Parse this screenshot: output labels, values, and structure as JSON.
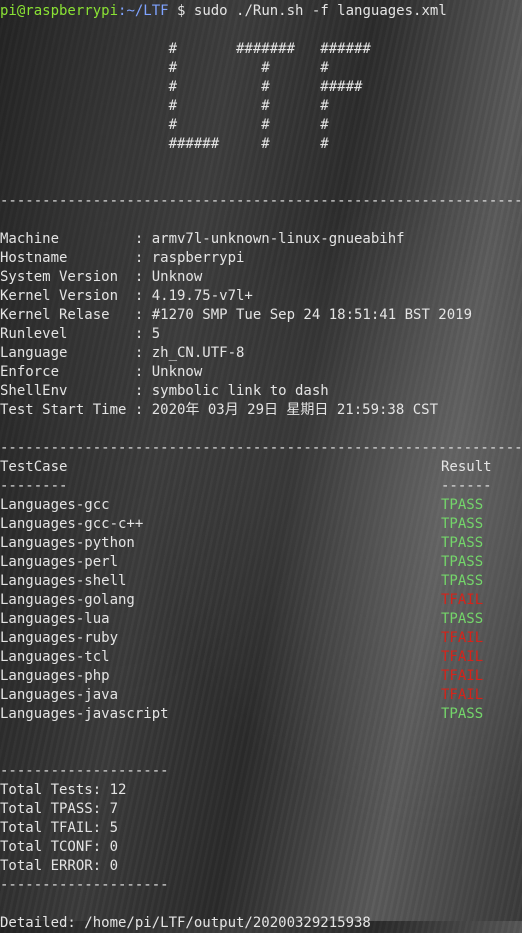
{
  "prompt": {
    "user_host": "pi@raspberrypi",
    "path": ":~/LTF",
    "symbol": " $ ",
    "command": "sudo ./Run.sh -f languages.xml"
  },
  "banner": [
    "                    #       #######   ######",
    "                    #          #      #",
    "                    #          #      #####",
    "                    #          #      #",
    "                    #          #      #",
    "                    ######     #      #"
  ],
  "separators": {
    "long": "--------------------------------------------------------------------",
    "short": "--------------------"
  },
  "system_info": [
    {
      "key": "Machine         ",
      "value": "armv7l-unknown-linux-gnueabihf"
    },
    {
      "key": "Hostname        ",
      "value": "raspberrypi"
    },
    {
      "key": "System Version  ",
      "value": "Unknow"
    },
    {
      "key": "Kernel Version  ",
      "value": "4.19.75-v7l+"
    },
    {
      "key": "Kernel Relase   ",
      "value": "#1270 SMP Tue Sep 24 18:51:41 BST 2019"
    },
    {
      "key": "Runlevel        ",
      "value": "5"
    },
    {
      "key": "Language        ",
      "value": "zh_CN.UTF-8"
    },
    {
      "key": "Enforce         ",
      "value": "Unknow"
    },
    {
      "key": "ShellEnv        ",
      "value": "symbolic link to dash"
    },
    {
      "key": "Test Start Time ",
      "value": "2020年 03月 29日 星期日 21:59:38 CST"
    }
  ],
  "results_header": {
    "testcase": "TestCase",
    "result": "Result",
    "testcase_underline": "--------",
    "result_underline": "------"
  },
  "results": [
    {
      "name": "Languages-gcc",
      "result": "TPASS",
      "color": "#74d66a"
    },
    {
      "name": "Languages-gcc-c++",
      "result": "TPASS",
      "color": "#74d66a"
    },
    {
      "name": "Languages-python",
      "result": "TPASS",
      "color": "#74d66a"
    },
    {
      "name": "Languages-perl",
      "result": "TPASS",
      "color": "#74d66a"
    },
    {
      "name": "Languages-shell",
      "result": "TPASS",
      "color": "#74d66a"
    },
    {
      "name": "Languages-golang",
      "result": "TFAIL",
      "color": "#d6231a"
    },
    {
      "name": "Languages-lua",
      "result": "TPASS",
      "color": "#74d66a"
    },
    {
      "name": "Languages-ruby",
      "result": "TFAIL",
      "color": "#d6231a"
    },
    {
      "name": "Languages-tcl",
      "result": "TFAIL",
      "color": "#d6231a"
    },
    {
      "name": "Languages-php",
      "result": "TFAIL",
      "color": "#d6231a"
    },
    {
      "name": "Languages-java",
      "result": "TFAIL",
      "color": "#d6231a"
    },
    {
      "name": "Languages-javascript",
      "result": "TPASS",
      "color": "#74d66a"
    }
  ],
  "totals": [
    "Total Tests: 12",
    "Total TPASS: 7",
    "Total TFAIL: 5",
    "Total TCONF: 0",
    "Total ERROR: 0"
  ],
  "detailed": "Detailed: /home/pi/LTF/output/20200329215938"
}
